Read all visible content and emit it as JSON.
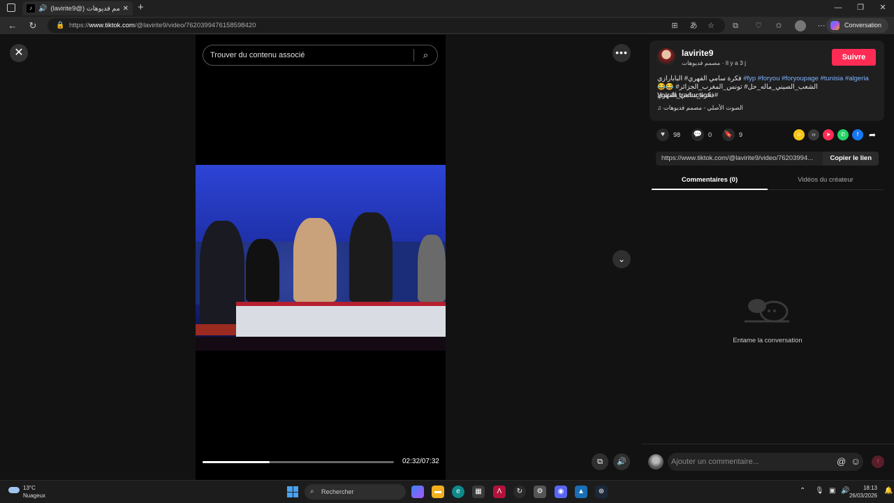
{
  "browser": {
    "tab_title": "(lavirite9@) مصمم فديوهات",
    "url_prefix": "https://",
    "url_domain": "www.tiktok.com",
    "url_path": "/@lavirite9/video/7620399476158598420",
    "copilot_label": "Conversation"
  },
  "video": {
    "search_placeholder": "Trouver du contenu associé",
    "progress": 0.35,
    "time": "02:32/07:32"
  },
  "post": {
    "username": "lavirite9",
    "subtitle": "مصمم فديوهات · Il y a 3 j",
    "follow_label": "Suivre",
    "description_line1": "فكرة سامي الفهري# البابارازي",
    "tags": "#fyp #foryou #foryoupage #tunisia #algeria",
    "description_line2": "😂😂 الشعب_الصيني_ماله_حل# تونس_المغرب_الجزائر# فكرة_سامي_الفهري#",
    "translate_label": "Voir la traduction",
    "music": "الصوت الأصلي - مصمم فديوهات"
  },
  "stats": {
    "likes": "98",
    "comments": "0",
    "saves": "9"
  },
  "share": {
    "link": "https://www.tiktok.com/@lavirite9/video/76203994...",
    "copy_label": "Copier le lien",
    "colors": {
      "friends": "#f5c518",
      "embed": "#3a3a3a",
      "send": "#fe2c55",
      "whatsapp": "#25d366",
      "facebook": "#1877f2"
    }
  },
  "panel_tabs": {
    "comments": "Commentaires (0)",
    "creator_videos": "Vidéos du créateur"
  },
  "empty_state": "Entame la conversation",
  "comment_input": {
    "placeholder": "Ajouter un commentaire..."
  },
  "taskbar": {
    "temperature": "13°C",
    "condition": "Nuageux",
    "search_label": "Rechercher",
    "time": "18:13",
    "date": "26/03/2026"
  },
  "accent_color": "#fe2c55"
}
